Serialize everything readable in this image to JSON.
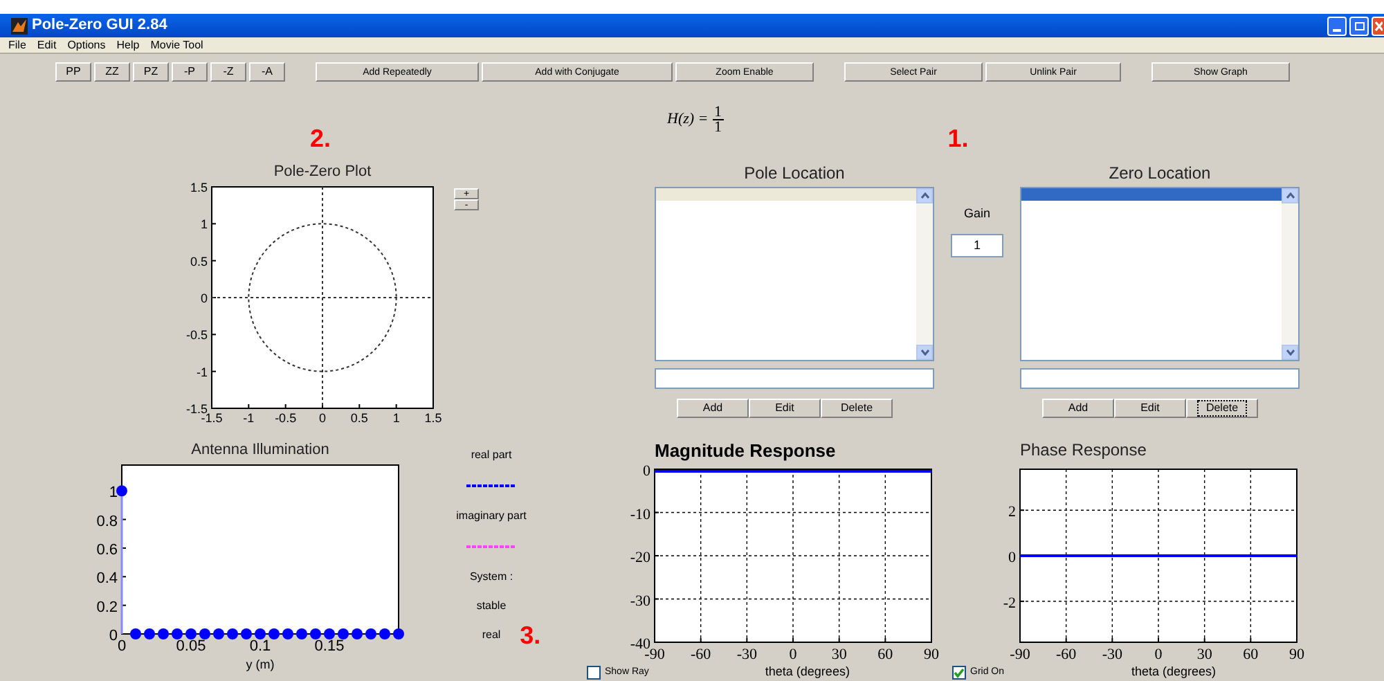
{
  "window": {
    "title": "Pole-Zero GUI 2.84"
  },
  "menu": [
    "File",
    "Edit",
    "Options",
    "Help",
    "Movie Tool"
  ],
  "toolbar": [
    {
      "kind": "small",
      "buttons": [
        "PP",
        "ZZ",
        "PZ",
        "-P",
        "-Z",
        "-A"
      ]
    },
    {
      "kind": "wide",
      "buttons": [
        "Add Repeatedly",
        "Add with Conjugate",
        "Zoom Enable"
      ]
    },
    {
      "kind": "wide",
      "buttons": [
        "Select Pair",
        "Unlink Pair"
      ]
    },
    {
      "kind": "wide",
      "buttons": [
        "Show Graph"
      ]
    }
  ],
  "transfer_function": {
    "lhs": "H(z) =",
    "numerator": "1",
    "denominator": "1",
    "marker": "1."
  },
  "pole_zero_plot": {
    "marker": "2.",
    "zoom_buttons": [
      "+",
      "-"
    ],
    "chart_data": {
      "type": "scatter",
      "title": "Pole-Zero Plot",
      "xlim": [
        -1.5,
        1.5
      ],
      "ylim": [
        -1.5,
        1.5
      ],
      "xticks": [
        -1.5,
        -1,
        -0.5,
        0,
        0.5,
        1,
        1.5
      ],
      "yticks": [
        -1.5,
        -1,
        -0.5,
        0,
        0.5,
        1,
        1.5
      ]
    }
  },
  "pole_panel": {
    "title": "Pole Location",
    "focused": false,
    "buttons": [
      {
        "label": "Add",
        "focused": false
      },
      {
        "label": "Edit",
        "focused": false
      },
      {
        "label": "Delete",
        "focused": false
      }
    ]
  },
  "gain": {
    "label": "Gain",
    "value": "1"
  },
  "zero_panel": {
    "title": "Zero Location",
    "focused": true,
    "buttons": [
      {
        "label": "Add",
        "focused": false
      },
      {
        "label": "Edit",
        "focused": false
      },
      {
        "label": "Delete",
        "focused": true
      }
    ]
  },
  "antenna": {
    "chart_data": {
      "type": "scatter",
      "title": "Antenna Illumination",
      "xlabel": "y (m)",
      "xlim": [
        0,
        0.2
      ],
      "ylim": [
        0,
        1.18
      ],
      "xticks": [
        0,
        0.05,
        0.1,
        0.15
      ],
      "yticks": [
        0,
        0.2,
        0.4,
        0.6,
        0.8,
        1
      ],
      "x": [
        0,
        0.01,
        0.02,
        0.03,
        0.04,
        0.05,
        0.06,
        0.07,
        0.08,
        0.09,
        0.1,
        0.11,
        0.12,
        0.13,
        0.14,
        0.15,
        0.16,
        0.17,
        0.18,
        0.19,
        0.2
      ],
      "series": [
        {
          "color": "#0000ff",
          "values": [
            1,
            0,
            0,
            0,
            0,
            0,
            0,
            0,
            0,
            0,
            0,
            0,
            0,
            0,
            0,
            0,
            0,
            0,
            0,
            0,
            0
          ]
        }
      ]
    }
  },
  "legend": [
    {
      "label": "real part",
      "color": "#0000ff"
    },
    {
      "label": "imaginary part",
      "color": "#ff44ff"
    }
  ],
  "system": {
    "lines": [
      "System :",
      "stable",
      "real"
    ],
    "marker": "3."
  },
  "magnitude": {
    "chart_data": {
      "type": "line",
      "title": "Magnitude Response",
      "xlabel": "theta (degrees)",
      "x": [
        -90,
        90
      ],
      "series": [
        {
          "color": "#0000ff",
          "values": [
            0,
            0
          ]
        }
      ],
      "grid": true,
      "xlim": [
        -90,
        90
      ],
      "ylim": [
        -40,
        0
      ],
      "xticks": [
        -90,
        -60,
        -30,
        0,
        30,
        60,
        90
      ],
      "yticks": [
        -40,
        -30,
        -20,
        -10,
        0
      ]
    }
  },
  "phase": {
    "chart_data": {
      "type": "line",
      "title": "Phase Response",
      "xlabel": "theta (degrees)",
      "x": [
        -90,
        90
      ],
      "series": [
        {
          "color": "#0000ff",
          "values": [
            0,
            0
          ]
        }
      ],
      "grid": true,
      "xlim": [
        -90,
        90
      ],
      "ylim": [
        -3.8,
        3.8
      ],
      "xticks": [
        -90,
        -60,
        -30,
        0,
        30,
        60,
        90
      ],
      "yticks": [
        -2,
        0,
        2
      ]
    }
  },
  "checkboxes": [
    {
      "label": "Show Ray",
      "checked": false
    },
    {
      "label": "Grid On",
      "checked": true
    }
  ]
}
